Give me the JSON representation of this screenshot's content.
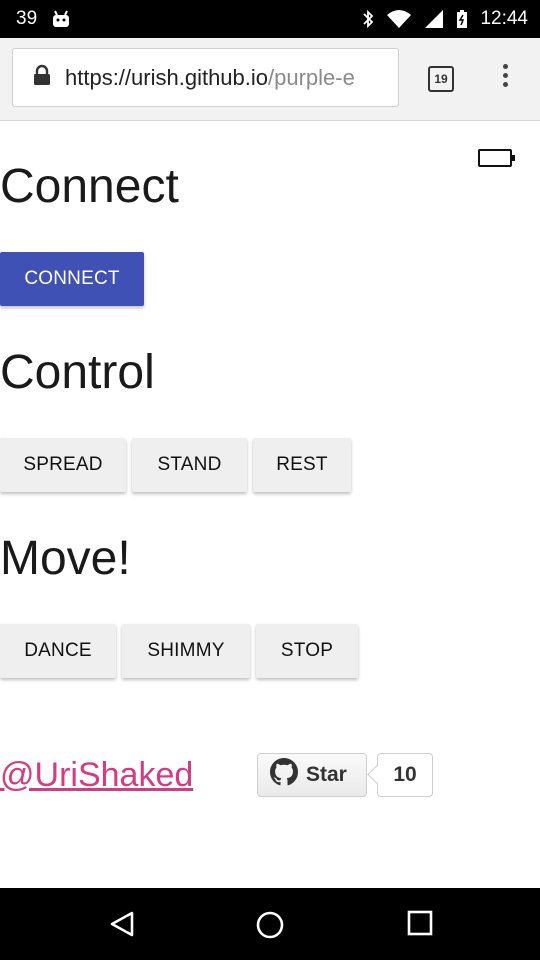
{
  "status_bar": {
    "notification_count": "39",
    "time": "12:44",
    "icons": [
      "android-icon",
      "bluetooth-icon",
      "wifi-icon",
      "signal-icon",
      "battery-icon"
    ]
  },
  "browser": {
    "url_host": "https://urish.github.io",
    "url_path": "/purple-e",
    "tab_count": "19"
  },
  "page": {
    "connect": {
      "heading": "Connect",
      "button": "CONNECT"
    },
    "control": {
      "heading": "Control",
      "buttons": [
        "SPREAD",
        "STAND",
        "REST"
      ]
    },
    "move": {
      "heading": "Move!",
      "buttons": [
        "DANCE",
        "SHIMMY",
        "STOP"
      ]
    },
    "footer": {
      "handle": "@UriShaked",
      "star_label": "Star",
      "star_count": "10"
    }
  },
  "colors": {
    "primary_button": "#3f51b5",
    "link": "#d63b82"
  }
}
